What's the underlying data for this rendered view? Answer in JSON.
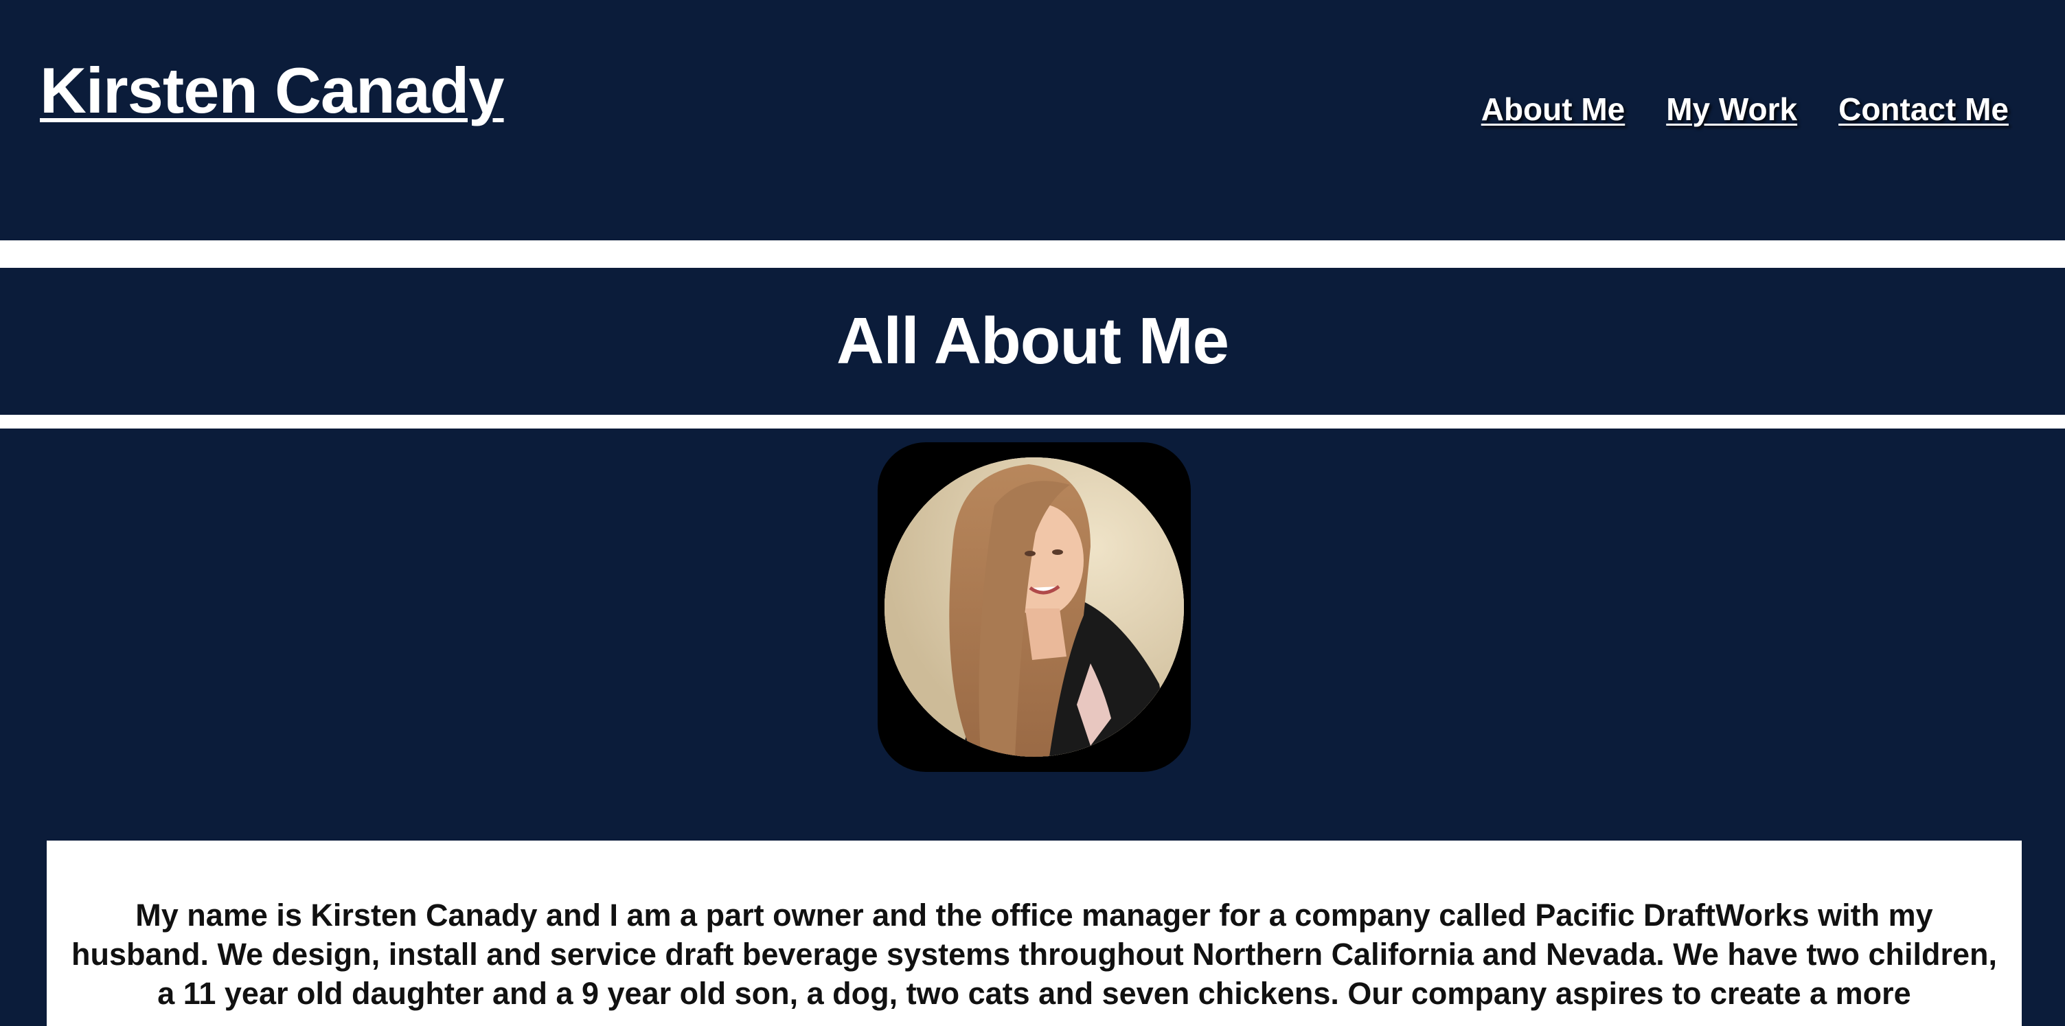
{
  "header": {
    "brand": "Kirsten Canady",
    "nav": [
      {
        "label": "About Me"
      },
      {
        "label": "My Work"
      },
      {
        "label": "Contact Me"
      }
    ]
  },
  "section": {
    "title": "All About Me"
  },
  "portrait": {
    "icon": "profile-photo"
  },
  "about": {
    "text": "My name is Kirsten Canady and I am a part owner and the office manager for a company called Pacific DraftWorks with my husband. We design, install and service draft beverage systems throughout Northern California and Nevada. We have two children, a 11 year old daughter and a 9 year old son, a dog, two cats and seven chickens. Our company aspires to create a more"
  },
  "colors": {
    "background": "#0b1c3a",
    "band": "#ffffff",
    "text_light": "#ffffff",
    "text_dark": "#111111"
  }
}
